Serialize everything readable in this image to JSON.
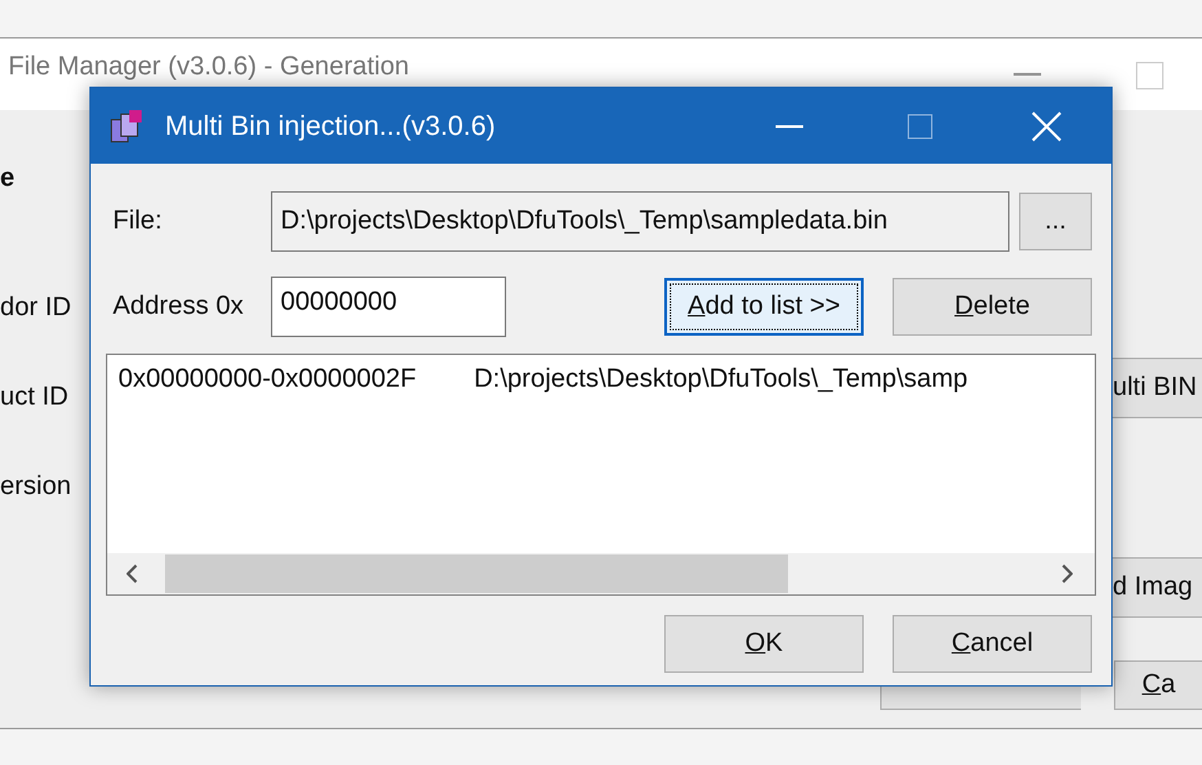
{
  "background_window": {
    "title": "File Manager (v3.0.6) - Generation",
    "labels": [
      {
        "kind": "menu",
        "text": "e"
      },
      {
        "kind": "label1",
        "text": "dor ID"
      },
      {
        "kind": "label2",
        "text": "uct ID"
      },
      {
        "kind": "label3",
        "text": "ersion"
      }
    ],
    "buttons": [
      {
        "kind": "multi",
        "text": "ulti BIN"
      },
      {
        "kind": "image",
        "text": "d Imag"
      },
      {
        "kind": "generate"
      },
      {
        "kind": "cancel",
        "text": "Ca",
        "mnemonic": true
      }
    ]
  },
  "dialog": {
    "title": "Multi Bin injection...(v3.0.6)",
    "file": {
      "label": "File:",
      "value": "D:\\projects\\Desktop\\DfuTools\\_Temp\\sampledata.bin",
      "browse": "..."
    },
    "address": {
      "label": "Address 0x",
      "value": "00000000"
    },
    "buttons": [
      {
        "text": "Add to list >>",
        "mnemonic": true,
        "focused": true
      },
      {
        "text": "Delete",
        "mnemonic": true,
        "focused": false
      }
    ],
    "list": [
      {
        "range": "0x00000000-0x0000002F",
        "path": "D:\\projects\\Desktop\\DfuTools\\_Temp\\samp"
      }
    ],
    "footer_buttons": [
      {
        "text": "OK",
        "mnemonic": true
      },
      {
        "text": "Cancel",
        "mnemonic": true
      }
    ]
  }
}
